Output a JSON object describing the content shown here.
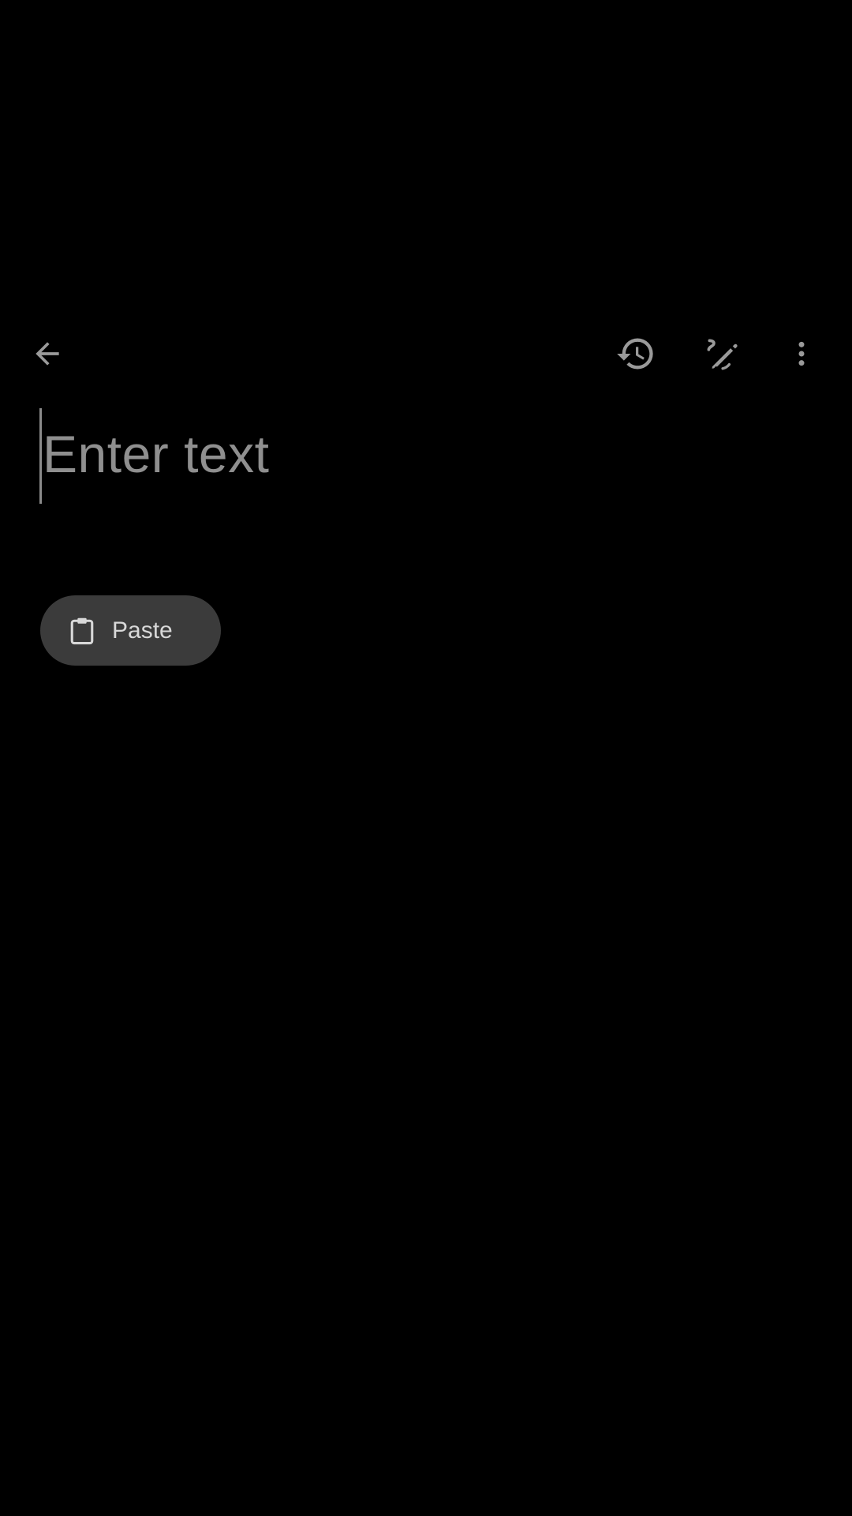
{
  "toolbar": {
    "back_icon": "arrow-back-icon",
    "history_icon": "history-icon",
    "handwriting_icon": "handwriting-icon",
    "more_icon": "more-vert-icon"
  },
  "editor": {
    "placeholder": "Enter text"
  },
  "suggestions": {
    "paste_label": "Paste",
    "paste_icon": "clipboard-icon"
  },
  "colors": {
    "background": "#000000",
    "icon": "#9a9a9a",
    "placeholder_text": "#8f8f8f",
    "chip_background": "#3b3b3b",
    "chip_text": "#d8d8d8"
  }
}
